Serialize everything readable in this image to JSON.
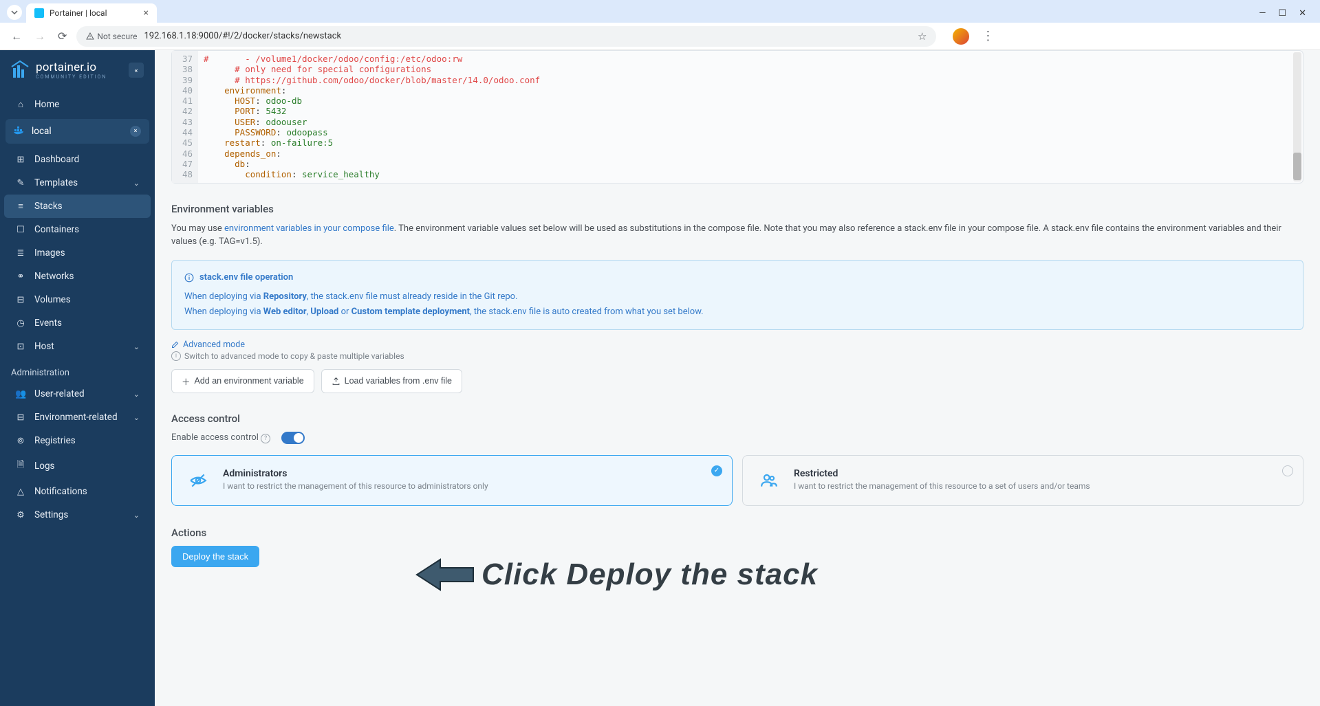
{
  "browser": {
    "tab_title": "Portainer | local",
    "url": "192.168.1.18:9000/#!/2/docker/stacks/newstack",
    "security_label": "Not secure"
  },
  "sidebar": {
    "brand": "portainer.io",
    "edition": "COMMUNITY EDITION",
    "home": "Home",
    "env_name": "local",
    "items": [
      {
        "icon": "⊞",
        "label": "Dashboard"
      },
      {
        "icon": "✎",
        "label": "Templates",
        "chev": true
      },
      {
        "icon": "≡",
        "label": "Stacks",
        "active": true
      },
      {
        "icon": "☐",
        "label": "Containers"
      },
      {
        "icon": "≣",
        "label": "Images"
      },
      {
        "icon": "⚭",
        "label": "Networks"
      },
      {
        "icon": "⊟",
        "label": "Volumes"
      },
      {
        "icon": "◷",
        "label": "Events"
      },
      {
        "icon": "⊡",
        "label": "Host",
        "chev": true
      }
    ],
    "admin_label": "Administration",
    "admin_items": [
      {
        "icon": "👥",
        "label": "User-related",
        "chev": true
      },
      {
        "icon": "⊟",
        "label": "Environment-related",
        "chev": true
      },
      {
        "icon": "⊚",
        "label": "Registries"
      },
      {
        "icon": "🗎",
        "label": "Logs"
      },
      {
        "icon": "△",
        "label": "Notifications"
      },
      {
        "icon": "⚙",
        "label": "Settings",
        "chev": true
      }
    ]
  },
  "editor": {
    "lines": [
      {
        "n": 37,
        "html": "<span class='c-comment'>#       - /volume1/docker/odoo/config:/etc/odoo:rw</span>"
      },
      {
        "n": 38,
        "html": "      <span class='c-comment'># only need for special configurations</span>"
      },
      {
        "n": 39,
        "html": "      <span class='c-comment'># https://github.com/odoo/docker/blob/master/14.0/odoo.conf</span>"
      },
      {
        "n": 40,
        "html": "    <span class='c-key'>environment</span>:"
      },
      {
        "n": 41,
        "html": "      <span class='c-key'>HOST</span>: <span class='c-val'>odoo-db</span>"
      },
      {
        "n": 42,
        "html": "      <span class='c-key'>PORT</span>: <span class='c-val'>5432</span>"
      },
      {
        "n": 43,
        "html": "      <span class='c-key'>USER</span>: <span class='c-val'>odoouser</span>"
      },
      {
        "n": 44,
        "html": "      <span class='c-key'>PASSWORD</span>: <span class='c-val'>odoopass</span>"
      },
      {
        "n": 45,
        "html": "    <span class='c-key'>restart</span>: <span class='c-val'>on-failure:5</span>"
      },
      {
        "n": 46,
        "html": "    <span class='c-key'>depends_on</span>:"
      },
      {
        "n": 47,
        "html": "      <span class='c-key'>db</span>:"
      },
      {
        "n": 48,
        "html": "        <span class='c-key'>condition</span>: <span class='c-val'>service_healthy</span>"
      }
    ]
  },
  "env_section": {
    "title": "Environment variables",
    "desc_pre": "You may use ",
    "desc_link": "environment variables in your compose file",
    "desc_post": ". The environment variable values set below will be used as substitutions in the compose file. Note that you may also reference a stack.env file in your compose file. A stack.env file contains the environment variables and their values (e.g. TAG=v1.5).",
    "info_title": "stack.env file operation",
    "info_l1_pre": "When deploying via ",
    "info_l1_b1": "Repository",
    "info_l1_post": ", the stack.env file must already reside in the Git repo.",
    "info_l2_pre": "When deploying via ",
    "info_l2_b1": "Web editor",
    "info_l2_b2": "Upload",
    "info_l2_b3": "Custom template deployment",
    "info_l2_or": " or ",
    "info_l2_sep": ", ",
    "info_l2_post": ", the stack.env file is auto created from what you set below.",
    "adv_link": "Advanced mode",
    "adv_hint": "Switch to advanced mode to copy & paste multiple variables",
    "btn_add": "Add an environment variable",
    "btn_load": "Load variables from .env file"
  },
  "access": {
    "title": "Access control",
    "enable_label": "Enable access control",
    "cards": [
      {
        "title": "Administrators",
        "desc": "I want to restrict the management of this resource to administrators only",
        "icon": "eye-off",
        "selected": true
      },
      {
        "title": "Restricted",
        "desc": "I want to restrict the management of this resource to a set of users and/or teams",
        "icon": "users",
        "selected": false
      }
    ]
  },
  "actions": {
    "title": "Actions",
    "deploy": "Deploy the stack"
  },
  "annotation": "Click Deploy the stack"
}
